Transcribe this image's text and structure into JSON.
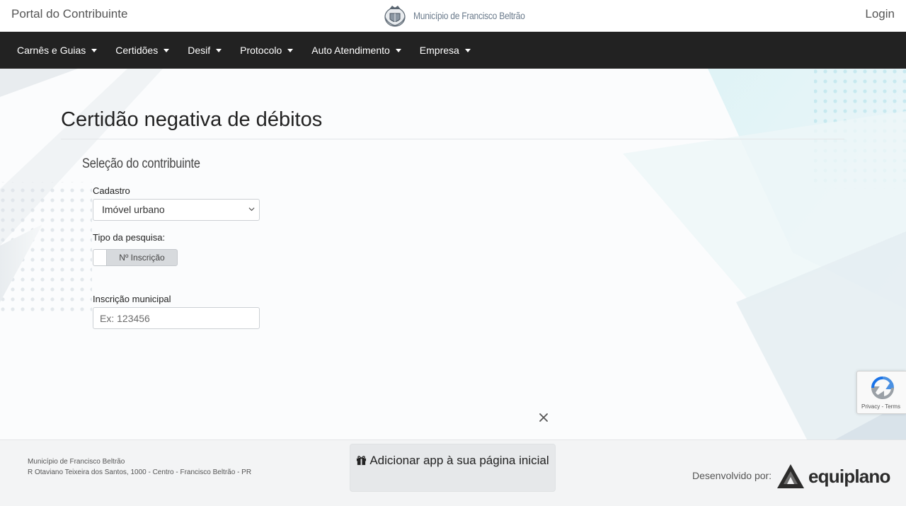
{
  "header": {
    "brand": "Portal do Contribuinte",
    "municipality": "Município de Francisco Beltrão",
    "login": "Login"
  },
  "nav": {
    "items": [
      {
        "label": "Carnês e Guias"
      },
      {
        "label": "Certidões"
      },
      {
        "label": "Desif"
      },
      {
        "label": "Protocolo"
      },
      {
        "label": "Auto Atendimento"
      },
      {
        "label": "Empresa"
      }
    ]
  },
  "main": {
    "title": "Certidão negativa de débitos",
    "section_title": "Seleção do contribuinte",
    "cadastro_label": "Cadastro",
    "cadastro_value": "Imóvel urbano",
    "tipo_label": "Tipo da pesquisa:",
    "tipo_toggle": "Nº Inscrição",
    "inscricao_label": "Inscrição municipal",
    "inscricao_placeholder": "Ex: 123456",
    "inscricao_value": ""
  },
  "recaptcha": {
    "links": "Privacy - Terms"
  },
  "footer": {
    "name": "Município de Francisco Beltrão",
    "address": "R Otaviano Teixeira dos Santos, 1000 - Centro - Francisco Beltrão - PR",
    "add_app": "Adicionar app à sua página inicial",
    "developed_by": "Desenvolvido por:",
    "developer": "equiplano"
  },
  "colors": {
    "navbar_bg": "#222222",
    "footer_bg": "#f3f4f5",
    "toggle_bg": "#d7dadd",
    "accent_teal": "#bfe6ec"
  },
  "icons": [
    "municipal-seal-icon",
    "caret-down-icon",
    "chevron-down-icon",
    "recaptcha-icon",
    "close-icon",
    "gift-icon",
    "equiplano-logo-icon"
  ]
}
